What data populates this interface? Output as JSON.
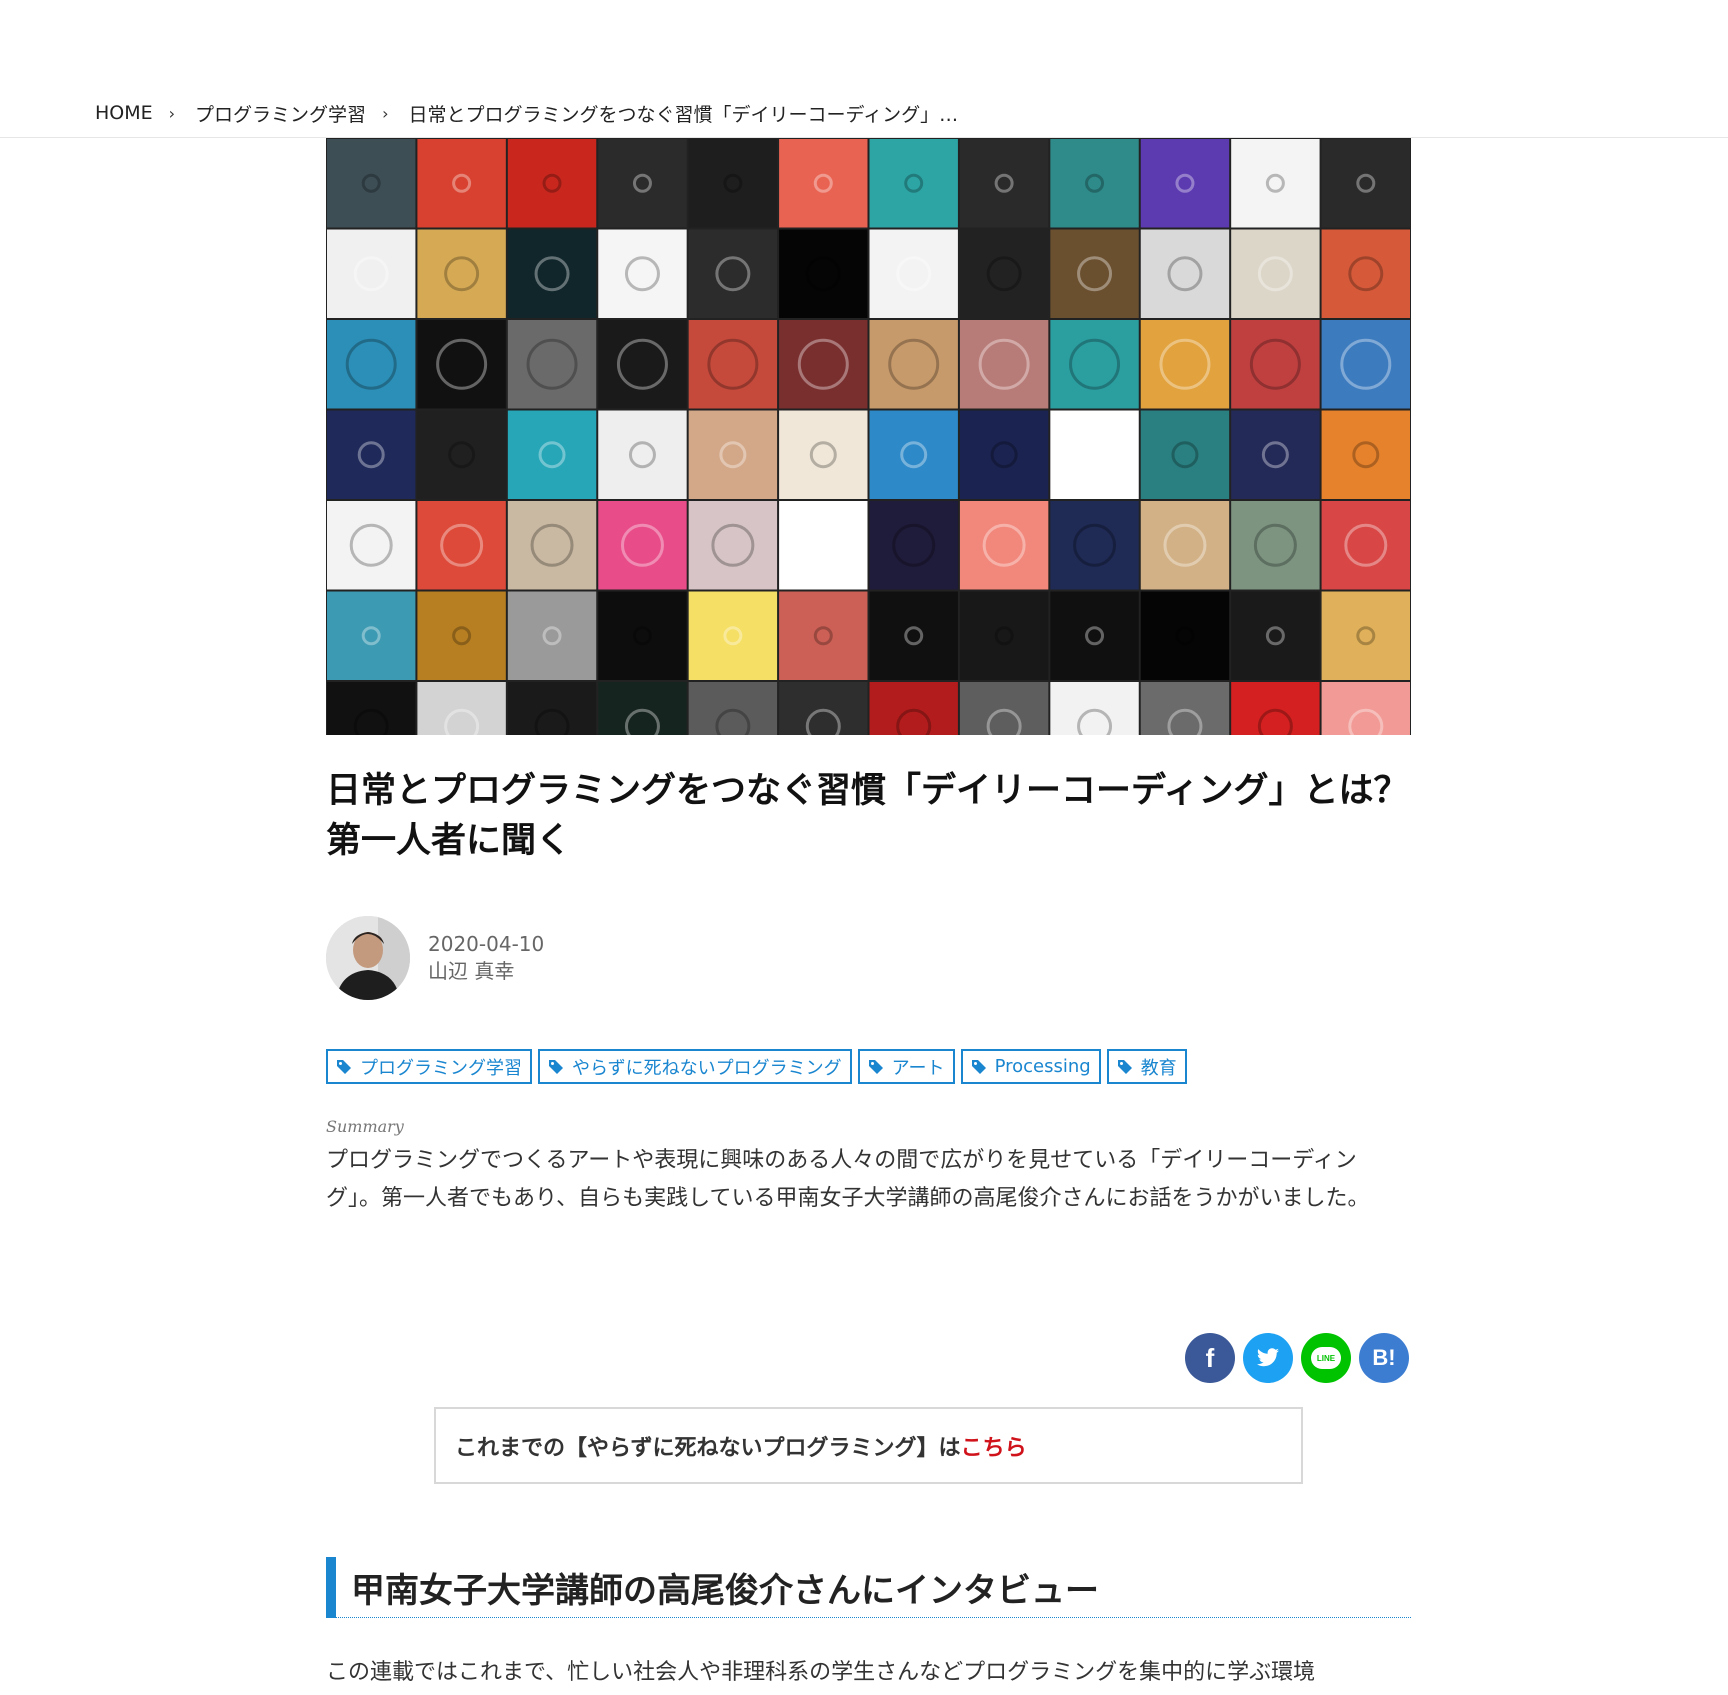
{
  "breadcrumb": {
    "home": "HOME",
    "category": "プログラミング学習",
    "current": "日常とプログラミングをつなぐ習慣「デイリーコーディング」…"
  },
  "article": {
    "title": "日常とプログラミングをつなぐ習慣「デイリーコーディング」とは？ 第一人者に聞く",
    "date": "2020-04-10",
    "author": "山辺 真幸"
  },
  "tags": [
    "プログラミング学習",
    "やらずに死ねないプログラミング",
    "アート",
    "Processing",
    "教育"
  ],
  "summary": {
    "label": "Summary",
    "text": "プログラミングでつくるアートや表現に興味のある人々の間で広がりを見せている「デイリーコーディング」。第一人者でもあり、自らも実践している甲南女子大学講師の高尾俊介さんにお話をうかがいました。"
  },
  "share": {
    "facebook": "f",
    "twitter": "twitter-icon",
    "line": "LINE",
    "hatena": "B!"
  },
  "series": {
    "prefix": "これまでの【やらずに死ねないプログラミング】は",
    "link": "こちら"
  },
  "section": {
    "heading": "甲南女子大学講師の高尾俊介さんにインタビュー",
    "body": "この連載ではこれまで、忙しい社会人や非理科系の学生さんなどプログラミングを集中的に学ぶ環境"
  },
  "colors": {
    "accent": "#1a86d0",
    "link_red": "#d0121b",
    "facebook": "#3b5998",
    "twitter": "#1da1f2",
    "line": "#00c300",
    "hatena": "#3c7dd1"
  },
  "hero_tiles": [
    [
      "#3d4e55",
      "#d8412f",
      "#c9271e",
      "#2b2b2b",
      "#1e1e1e",
      "#e96352",
      "#2ea5a5",
      "#2a2a2a",
      "#2f8a8a",
      "#5c3bb0",
      "#f4f4f4",
      "#2a2a2a"
    ],
    [
      "#f0f0f0",
      "#d6aa55",
      "#10262b",
      "#f5f5f5",
      "#2c2c2c",
      "#050505",
      "#f3f3f3",
      "#222222",
      "#6b5030",
      "#d9d9d9",
      "#dcd6c8",
      "#d65a3a"
    ],
    [
      "#2c8fb7",
      "#111111",
      "#6a6a6a",
      "#1a1a1a",
      "#c54a3c",
      "#7a2f2f",
      "#c79a6b",
      "#b87c78",
      "#2b9ea0",
      "#e2a23d",
      "#c04040",
      "#3d7bbf"
    ],
    [
      "#1f2a5a",
      "#202020",
      "#27a6b7",
      "#eeeeee",
      "#d3a889",
      "#f0e7d8",
      "#2e89c8",
      "#1b2350",
      "#ffffff",
      "#2a7f80",
      "#242a58",
      "#e6822c"
    ],
    [
      "#f3f3f3",
      "#dd4a39",
      "#c9b8a2",
      "#e84d8a",
      "#d6c4c6",
      "#ffffff",
      "#1f1b3a",
      "#f2877c",
      "#1f2a55",
      "#d2b186",
      "#7d9480",
      "#d84746"
    ],
    [
      "#3c9ab2",
      "#b77f22",
      "#9a9a9a",
      "#0d0d0d",
      "#f5df64",
      "#cc6056",
      "#101010",
      "#181818",
      "#101010",
      "#050505",
      "#1a1a1a",
      "#e0b15a"
    ],
    [
      "#111111",
      "#d3d3d3",
      "#1a1a1a",
      "#16241f",
      "#5b5b5b",
      "#2e2e2e",
      "#b31c1c",
      "#5e5e5e",
      "#f2f2f2",
      "#6b6b6b",
      "#d42020",
      "#f29b96"
    ]
  ]
}
